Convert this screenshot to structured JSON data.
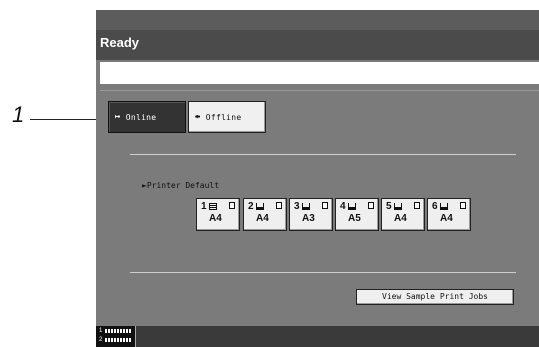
{
  "callout": {
    "number": "1"
  },
  "titlebar": {
    "status": "Ready"
  },
  "message_bar": {
    "text": ""
  },
  "mode_buttons": {
    "online": {
      "label": "Online",
      "icon": "online-arrow-icon",
      "selected": true
    },
    "offline": {
      "label": "Offline",
      "icon": "offline-arrow-icon",
      "selected": false
    }
  },
  "printer_default": {
    "label": "►Printer Default"
  },
  "trays": [
    {
      "number": "1",
      "size": "A4",
      "level": 1.0
    },
    {
      "number": "2",
      "size": "A4",
      "level": 0.3
    },
    {
      "number": "3",
      "size": "A3",
      "level": 0.3
    },
    {
      "number": "4",
      "size": "A5",
      "level": 0.3
    },
    {
      "number": "5",
      "size": "A4",
      "level": 0.3
    },
    {
      "number": "6",
      "size": "A4",
      "level": 0.3
    }
  ],
  "view_sample": {
    "label": "View Sample Print Jobs"
  },
  "bottom_status": {
    "slots": [
      "1",
      "2"
    ]
  },
  "colors": {
    "background": "#7b7b7b",
    "titlebar": "#4b4b4b",
    "selected": "#333333",
    "button": "#efefef"
  }
}
